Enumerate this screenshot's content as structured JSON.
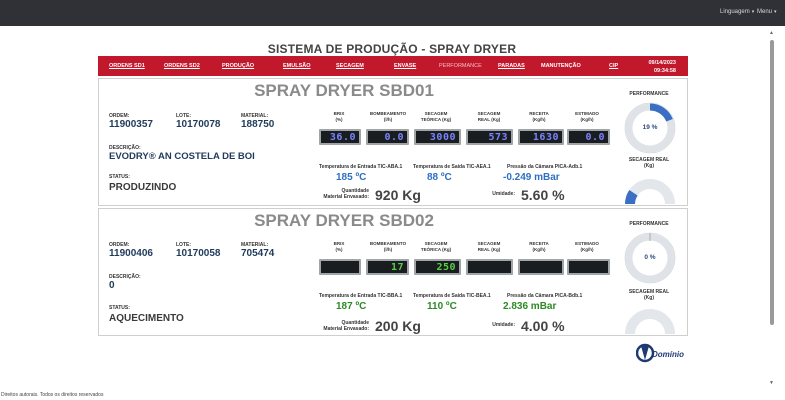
{
  "header": {
    "language_menu": "Linguagem",
    "menu": "Menu"
  },
  "app_title": "SISTEMA DE PRODUÇÃO - SPRAY DRYER",
  "nav": {
    "items": [
      "ORDENS SD1",
      "ORDENS SD2",
      "PRODUÇÃO",
      "EMULSÃO",
      "SECAGEM",
      "ENVASE",
      "PERFORMANCE",
      "PARADAS",
      "MANUTENÇÃO",
      "CIP"
    ],
    "date": "09/14/2023",
    "time": "09:34:58"
  },
  "labels": {
    "ordem": "ORDEM:",
    "lote": "LOTE:",
    "material": "MATERIAL:",
    "descricao": "DESCRIÇÃO:",
    "status": "STATUS:",
    "brix": "BRIX\n(%)",
    "bombeamento": "BOMBEAMENTO\n(l/h)",
    "secagem_teorica": "SECAGEM\nTEÓRICA (Kg)",
    "secagem_real": "SECAGEM\nREAL (Kg)",
    "receita": "RECEITA\n(Kg/h)",
    "estimado": "ESTIMADO\n(Kg/h)",
    "quantidade": "Quantidade\nMaterial Envasado:",
    "umidade": "Umidade:",
    "performance": "PERFORMANCE",
    "secagem_real_gauge": "SECAGEM REAL\n(Kg)"
  },
  "dryers": [
    {
      "title": "SPRAY DRYER SBD01",
      "ordem": "11900357",
      "lote": "10170078",
      "material": "188750",
      "descricao": "EVODRY® AN COSTELA DE BOI",
      "status": "PRODUZINDO",
      "lcd": [
        "36.0",
        "0.0",
        "3000",
        "573",
        "1630",
        "0.0"
      ],
      "temp_in_label": "Temperatura de Entrada TIC-ABA.1",
      "temp_in": "185 ºC",
      "temp_out_label": "Temperatura de Saída TIC-AEA.1",
      "temp_out": "88 ºC",
      "pressure_label": "Pressão da Câmara PICA-Adb.1",
      "pressure": "-0.249 mBar",
      "quantidade": "920 Kg",
      "umidade": "5.60 %",
      "performance": "19 %",
      "performance_value": 0.19,
      "secagem_gauge_value": 0.19
    },
    {
      "title": "SPRAY DRYER SBD02",
      "ordem": "11900406",
      "lote": "10170058",
      "material": "705474",
      "descricao": "0",
      "status": "AQUECIMENTO",
      "lcd": [
        "",
        "17",
        "250",
        "",
        "",
        ""
      ],
      "temp_in_label": "Temperatura de Entrada TIC-BBA.1",
      "temp_in": "187 ºC",
      "temp_out_label": "Temperatura de Saída TIC-BEA.1",
      "temp_out": "110 ºC",
      "pressure_label": "Pressão da Câmara PICA-Bdb.1",
      "pressure": "2.836 mBar",
      "quantidade": "200 Kg",
      "umidade": "4.00 %",
      "performance": "0 %",
      "performance_value": 0.0,
      "secagem_gauge_value": 0.0
    }
  ],
  "footer": "Direitos autorais. Todos os direitos reservados",
  "logo_text": "Domínio",
  "colors": {
    "nav_red": "#c1182c",
    "value_blue": "#2f6fc3",
    "value_green": "#2c8a24",
    "gauge_blue": "#3a6fc4"
  }
}
